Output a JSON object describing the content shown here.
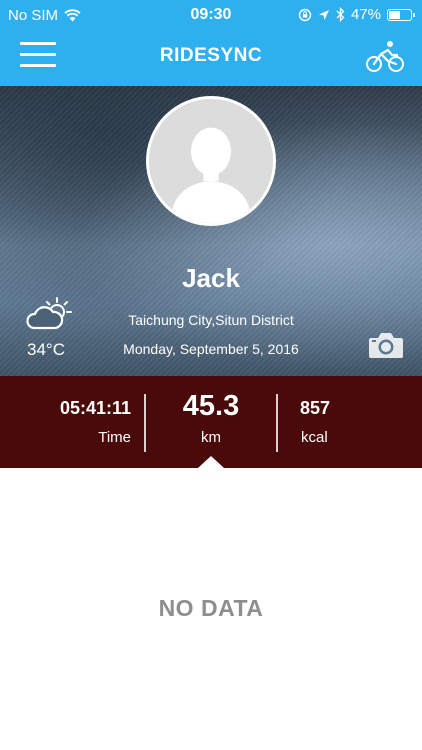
{
  "status_bar": {
    "carrier": "No SIM",
    "time": "09:30",
    "battery_percent": "47%",
    "battery_level": 0.47,
    "icons": [
      "wifi-icon",
      "rotation-lock-icon",
      "location-arrow-icon",
      "bluetooth-icon",
      "battery-icon"
    ]
  },
  "header": {
    "title": "RIDESYNC",
    "menu_icon": "hamburger-menu-icon",
    "action_icon": "cyclist-icon"
  },
  "colors": {
    "header_bg": "#2eb0ee",
    "stats_bg": "#4a0a0a",
    "no_data_text": "#8e8e8e"
  },
  "profile": {
    "name": "Jack",
    "location": "Taichung City,Situn District",
    "date": "Monday, September 5, 2016",
    "avatar_icon": "default-avatar-icon",
    "camera_icon": "camera-icon"
  },
  "weather": {
    "icon": "partly-sunny-icon",
    "temperature": "34°C"
  },
  "stats": {
    "time": {
      "value": "05:41:11",
      "label": "Time"
    },
    "distance": {
      "value": "45.3",
      "label": "km"
    },
    "calories": {
      "value": "857",
      "label": "kcal"
    }
  },
  "content": {
    "empty_message": "NO DATA"
  }
}
